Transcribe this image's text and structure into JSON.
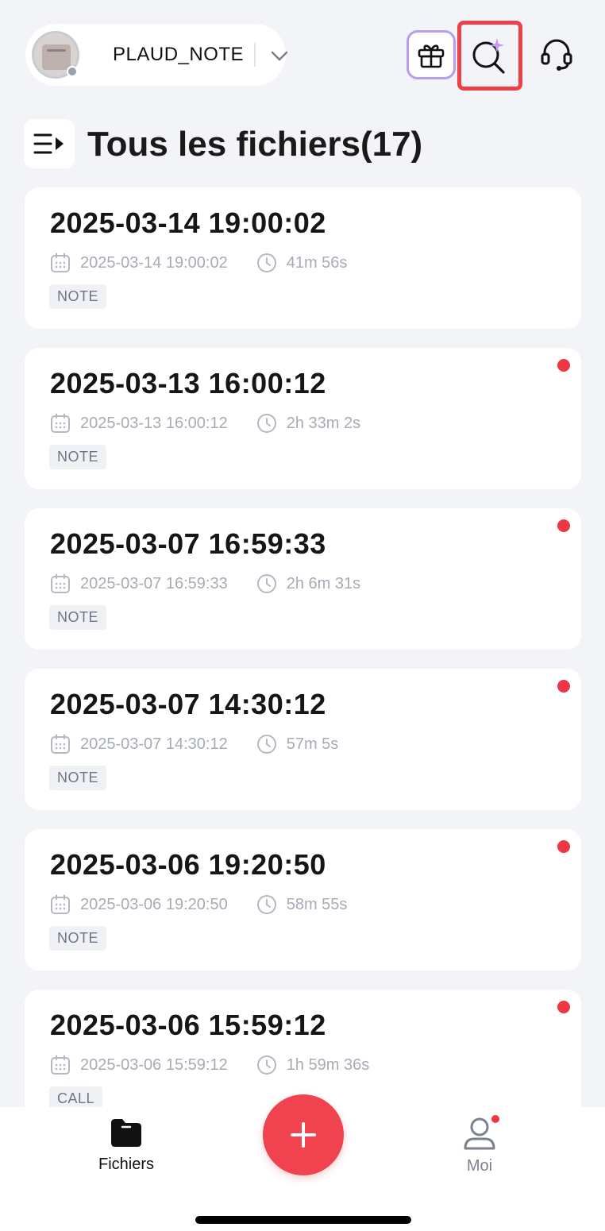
{
  "header": {
    "device_name": "PLAUD_NOTE",
    "icons": [
      "gift-icon",
      "ai-search-icon",
      "headset-icon"
    ]
  },
  "page": {
    "title": "Tous les fichiers(17)"
  },
  "files": [
    {
      "title": "2025-03-14 19:00:02",
      "date": "2025-03-14 19:00:02",
      "duration": "41m 56s",
      "tag": "NOTE",
      "unread": false
    },
    {
      "title": "2025-03-13 16:00:12",
      "date": "2025-03-13 16:00:12",
      "duration": "2h 33m 2s",
      "tag": "NOTE",
      "unread": true
    },
    {
      "title": "2025-03-07 16:59:33",
      "date": "2025-03-07 16:59:33",
      "duration": "2h 6m 31s",
      "tag": "NOTE",
      "unread": true
    },
    {
      "title": "2025-03-07 14:30:12",
      "date": "2025-03-07 14:30:12",
      "duration": "57m 5s",
      "tag": "NOTE",
      "unread": true
    },
    {
      "title": "2025-03-06 19:20:50",
      "date": "2025-03-06 19:20:50",
      "duration": "58m 55s",
      "tag": "NOTE",
      "unread": true
    },
    {
      "title": "2025-03-06 15:59:12",
      "date": "2025-03-06 15:59:12",
      "duration": "1h 59m 36s",
      "tag": "CALL",
      "unread": true
    }
  ],
  "nav": {
    "files_label": "Fichiers",
    "me_label": "Moi",
    "add_icon": "plus-icon"
  },
  "colors": {
    "accent": "#f0424f",
    "highlight_border": "#ef3f48",
    "background": "#f3f4f7"
  }
}
